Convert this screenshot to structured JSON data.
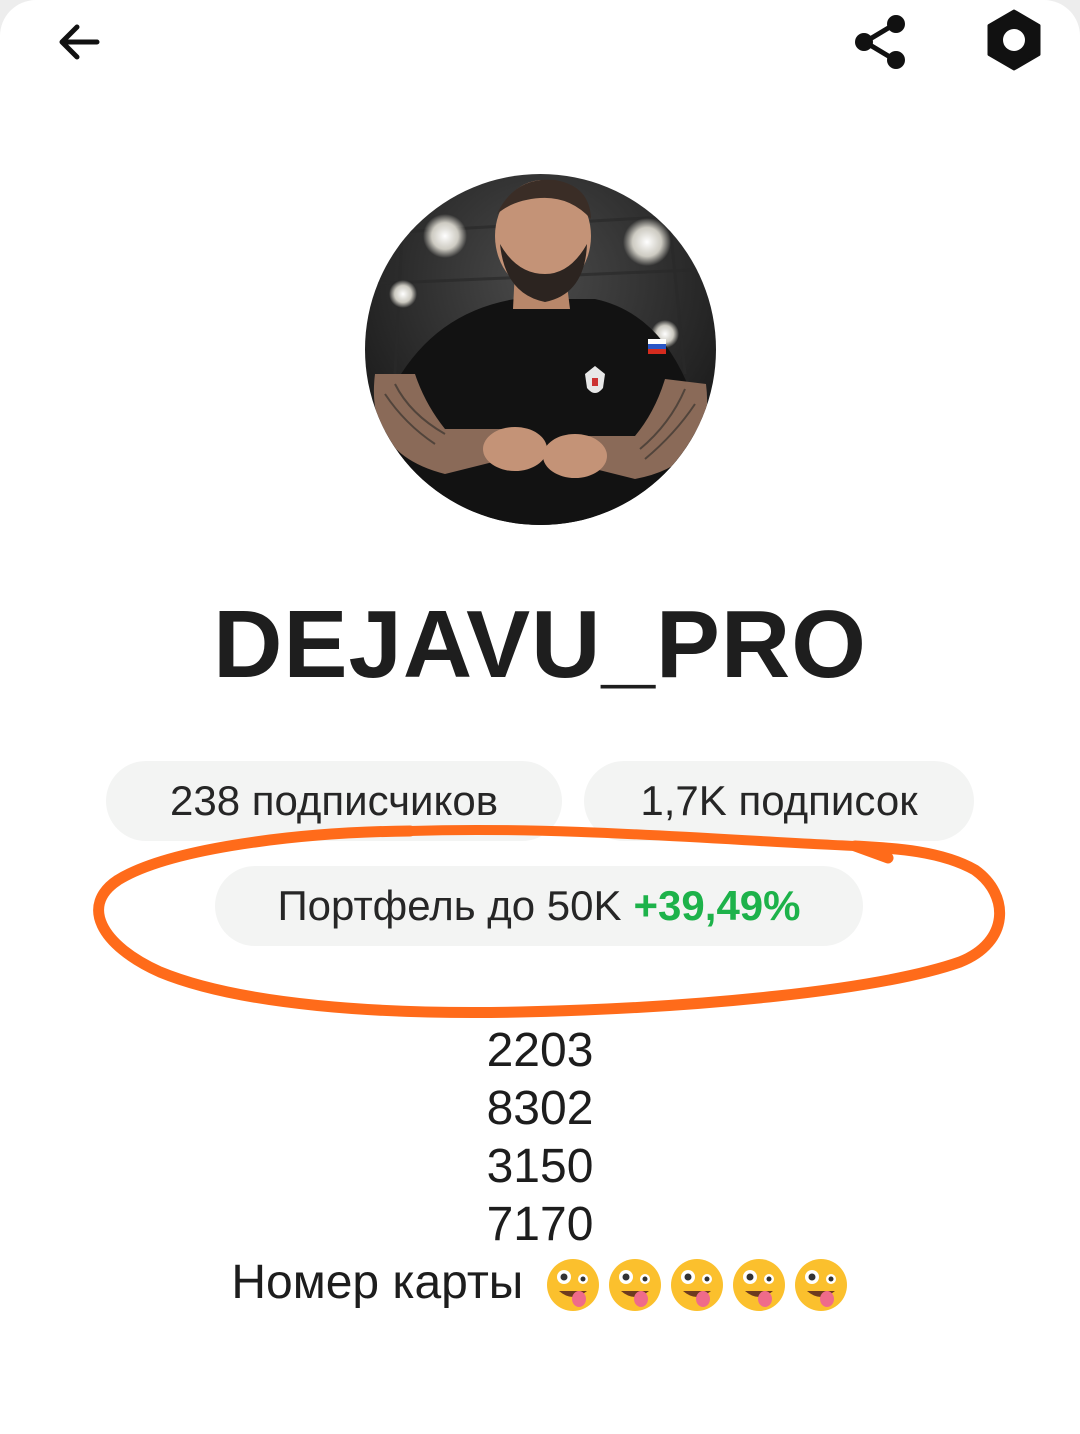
{
  "profile": {
    "username": "DEJAVU_PRO",
    "followers_label": "238 подписчиков",
    "following_label": "1,7K подписок",
    "portfolio_label": "Портфель до 50K",
    "portfolio_gain": "+39,49%"
  },
  "bio": {
    "lines": [
      "2203",
      "8302",
      "3150",
      "7170"
    ],
    "card_label": "Номер карты"
  },
  "icons": {
    "back": "arrow-left-icon",
    "share": "share-icon",
    "settings": "hexagon-settings-icon",
    "emoji": "zany-face-emoji"
  },
  "colors": {
    "gain": "#1db24a",
    "annotation": "#ff6b1a",
    "chip_bg": "#f3f4f3"
  }
}
